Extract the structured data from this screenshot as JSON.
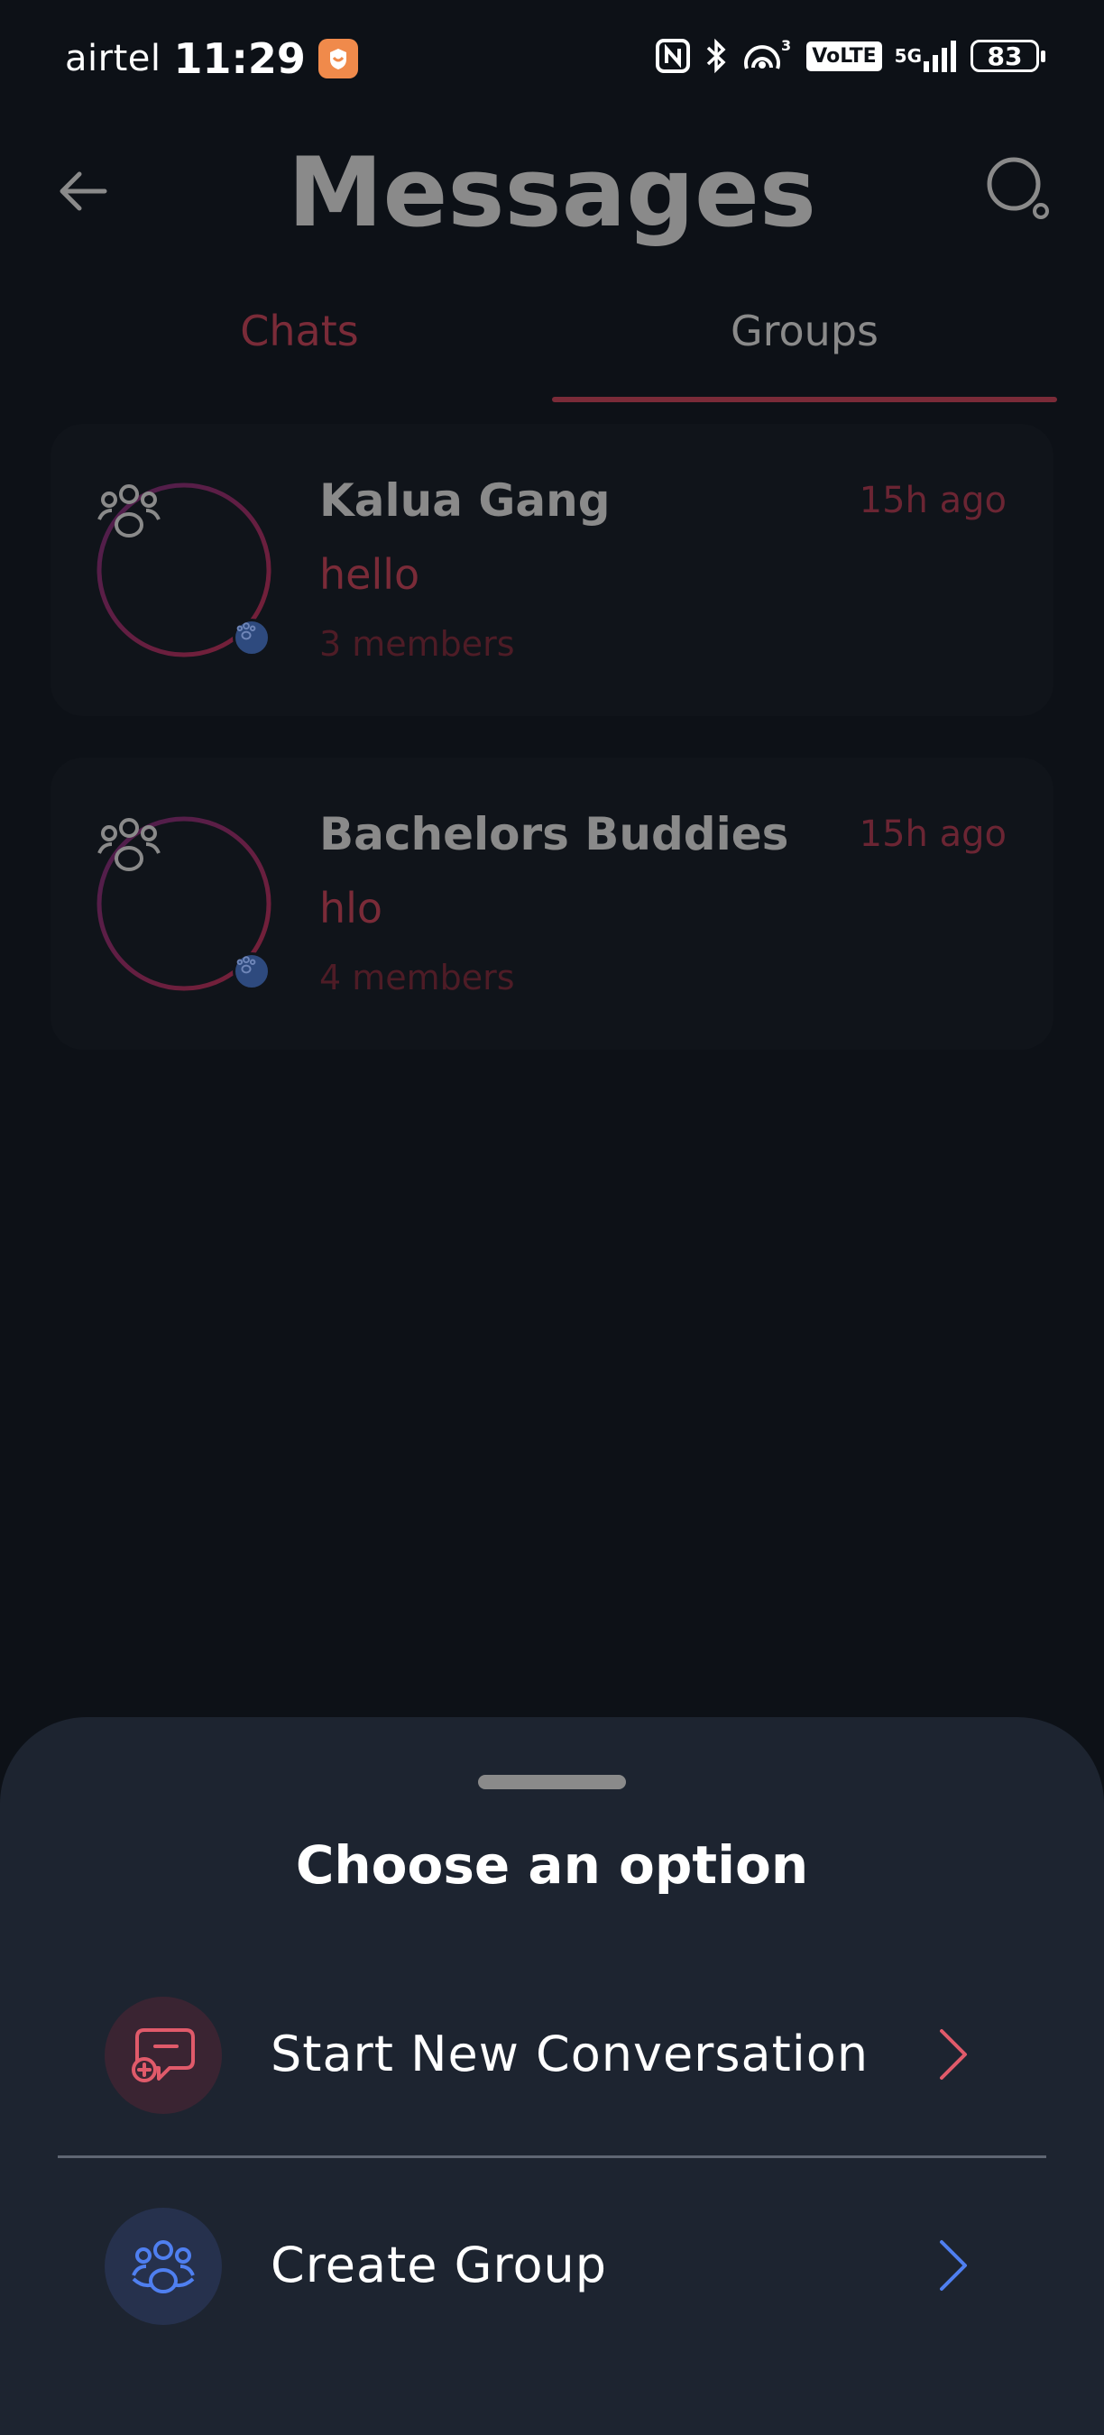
{
  "status_bar": {
    "carrier": "airtel",
    "time": "11:29",
    "network": "5G",
    "volte": "VoLTE",
    "hotspot_count": "3",
    "battery": "83"
  },
  "header": {
    "title": "Messages",
    "back_icon": "arrow-left-icon",
    "search_icon": "search-icon"
  },
  "tabs": [
    {
      "label": "Chats",
      "active": false
    },
    {
      "label": "Groups",
      "active": true
    }
  ],
  "groups": [
    {
      "name": "Kalua Gang",
      "time": "15h ago",
      "last_message": "hello",
      "members": "3 members"
    },
    {
      "name": "Bachelors Buddies",
      "time": "15h ago",
      "last_message": "hlo",
      "members": "4 members"
    }
  ],
  "sheet": {
    "title": "Choose an option",
    "options": [
      {
        "label": "Start New Conversation",
        "icon": "new-chat-icon",
        "color": "#e05a6a"
      },
      {
        "label": "Create Group",
        "icon": "group-icon",
        "color": "#4f7ff0"
      }
    ]
  },
  "colors": {
    "background": "#0d1117",
    "sheet": "#1d2430",
    "accent_red": "#e05a6a",
    "accent_blue": "#4f7ff0"
  }
}
